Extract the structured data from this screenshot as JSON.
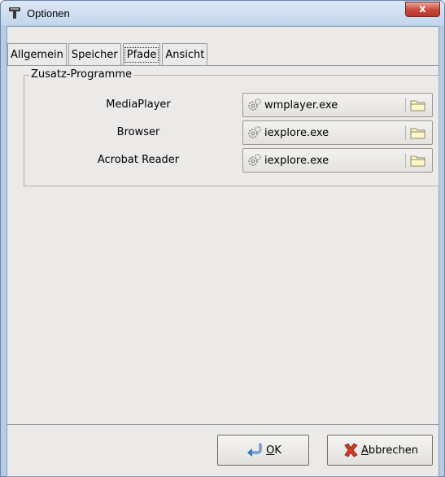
{
  "window": {
    "title": "Optionen",
    "close_glyph": "x"
  },
  "tabs": [
    {
      "label": "Allgemein",
      "active": false
    },
    {
      "label": "Speicher",
      "active": false
    },
    {
      "label": "Pfade",
      "active": true
    },
    {
      "label": "Ansicht",
      "active": false
    }
  ],
  "group": {
    "title": "Zusatz-Programme",
    "rows": [
      {
        "label": "MediaPlayer",
        "value": "wmplayer.exe"
      },
      {
        "label": "Browser",
        "value": "iexplore.exe"
      },
      {
        "label": "Acrobat Reader",
        "value": "iexplore.exe"
      }
    ]
  },
  "buttons": {
    "ok_mnemonic": "O",
    "ok_rest": "K",
    "cancel_mnemonic": "A",
    "cancel_rest": "bbrechen"
  },
  "icons": {
    "title": "tool-icon",
    "path_value": "gear-icon",
    "browse": "folder-icon",
    "ok": "return-arrow-icon",
    "cancel": "red-x-icon"
  },
  "colors": {
    "close_button": "#c9473a",
    "client_bg": "#ebeae8",
    "ok_arrow": "#2f6fc2",
    "cancel_x": "#d23a2a"
  }
}
